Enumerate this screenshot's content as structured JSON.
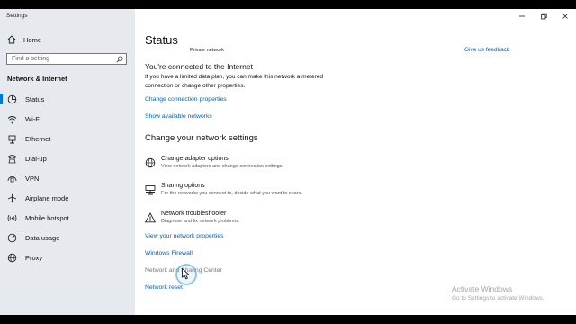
{
  "window": {
    "title": "Settings",
    "controls": [
      "minimize-icon",
      "maximize-icon",
      "close-icon"
    ]
  },
  "sidebar": {
    "home_label": "Home",
    "search_placeholder": "Find a setting",
    "section_title": "Network & Internet",
    "items": [
      {
        "label": "Status",
        "icon": "home-status-icon",
        "active": true
      },
      {
        "label": "Wi-Fi",
        "icon": "wifi-icon",
        "active": false
      },
      {
        "label": "Ethernet",
        "icon": "ethernet-icon",
        "active": false
      },
      {
        "label": "Dial-up",
        "icon": "dialup-icon",
        "active": false
      },
      {
        "label": "VPN",
        "icon": "vpn-icon",
        "active": false
      },
      {
        "label": "Airplane mode",
        "icon": "airplane-icon",
        "active": false
      },
      {
        "label": "Mobile hotspot",
        "icon": "hotspot-icon",
        "active": false
      },
      {
        "label": "Data usage",
        "icon": "data-usage-icon",
        "active": false
      },
      {
        "label": "Proxy",
        "icon": "globe-icon",
        "active": false
      }
    ]
  },
  "main": {
    "title": "Status",
    "clipped_top_text": "Private network",
    "clipped_feedback_link": "Give us feedback",
    "connected_heading": "You're connected to the Internet",
    "connected_body": "If you have a limited data plan, you can make this network a metered connection or change other properties.",
    "link_change_props": "Change connection properties",
    "link_show_networks": "Show available networks",
    "change_heading": "Change your network settings",
    "options": [
      {
        "title": "Change adapter options",
        "desc": "View network adapters and change connection settings.",
        "icon": "adapter-icon"
      },
      {
        "title": "Sharing options",
        "desc": "For the networks you connect to, decide what you want to share.",
        "icon": "sharing-icon"
      },
      {
        "title": "Network troubleshooter",
        "desc": "Diagnose and fix network problems.",
        "icon": "warning-icon"
      }
    ],
    "link_view_props": "View your network properties",
    "link_firewall": "Windows Firewall",
    "link_sharing_center": "Network and Sharing Center",
    "link_reset": "Network reset"
  },
  "watermark": {
    "line1": "Activate Windows",
    "line2": "Go to Settings to activate Windows."
  },
  "colors": {
    "accent": "#0078d7",
    "link": "#0063b1",
    "sidebar_bg": "#e6eaee"
  }
}
